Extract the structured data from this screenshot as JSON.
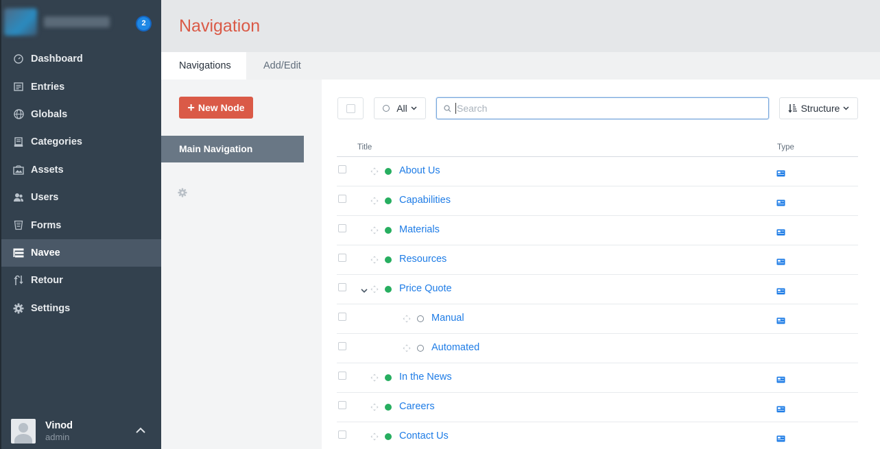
{
  "sidebar": {
    "badge": "2",
    "items": [
      {
        "label": "Dashboard",
        "icon": "dashboard-icon"
      },
      {
        "label": "Entries",
        "icon": "entries-icon"
      },
      {
        "label": "Globals",
        "icon": "globe-icon"
      },
      {
        "label": "Categories",
        "icon": "categories-icon"
      },
      {
        "label": "Assets",
        "icon": "assets-icon"
      },
      {
        "label": "Users",
        "icon": "users-icon"
      },
      {
        "label": "Forms",
        "icon": "forms-icon"
      },
      {
        "label": "Navee",
        "icon": "navee-icon",
        "active": true
      },
      {
        "label": "Retour",
        "icon": "retour-icon"
      },
      {
        "label": "Settings",
        "icon": "gear-icon"
      }
    ],
    "user": {
      "name": "Vinod",
      "role": "admin"
    }
  },
  "header": {
    "title": "Navigation"
  },
  "tabs": [
    {
      "label": "Navigations",
      "selected": true
    },
    {
      "label": "Add/Edit",
      "selected": false
    }
  ],
  "subpanel": {
    "new_node_label": "New Node",
    "navigation_item": "Main Navigation"
  },
  "toolbar": {
    "status_label": "All",
    "search_placeholder": "Search",
    "sort_label": "Structure"
  },
  "table": {
    "columns": [
      "Title",
      "Type"
    ],
    "rows": [
      {
        "title": "About Us",
        "enabled": true,
        "level": 1,
        "has_type": true
      },
      {
        "title": "Capabilities",
        "enabled": true,
        "level": 1,
        "has_type": true
      },
      {
        "title": "Materials",
        "enabled": true,
        "level": 1,
        "has_type": true
      },
      {
        "title": "Resources",
        "enabled": true,
        "level": 1,
        "has_type": true
      },
      {
        "title": "Price Quote",
        "enabled": true,
        "level": 1,
        "has_type": true,
        "expanded": true
      },
      {
        "title": "Manual",
        "enabled": false,
        "level": 2,
        "has_type": true
      },
      {
        "title": "Automated",
        "enabled": false,
        "level": 2,
        "has_type": false
      },
      {
        "title": "In the News",
        "enabled": true,
        "level": 1,
        "has_type": true
      },
      {
        "title": "Careers",
        "enabled": true,
        "level": 1,
        "has_type": true
      },
      {
        "title": "Contact Us",
        "enabled": true,
        "level": 1,
        "has_type": true
      }
    ]
  },
  "colors": {
    "accent": "#da5a47",
    "link": "#1e7ce6",
    "enabled": "#27ae60",
    "sidebar_bg": "#33414e"
  }
}
